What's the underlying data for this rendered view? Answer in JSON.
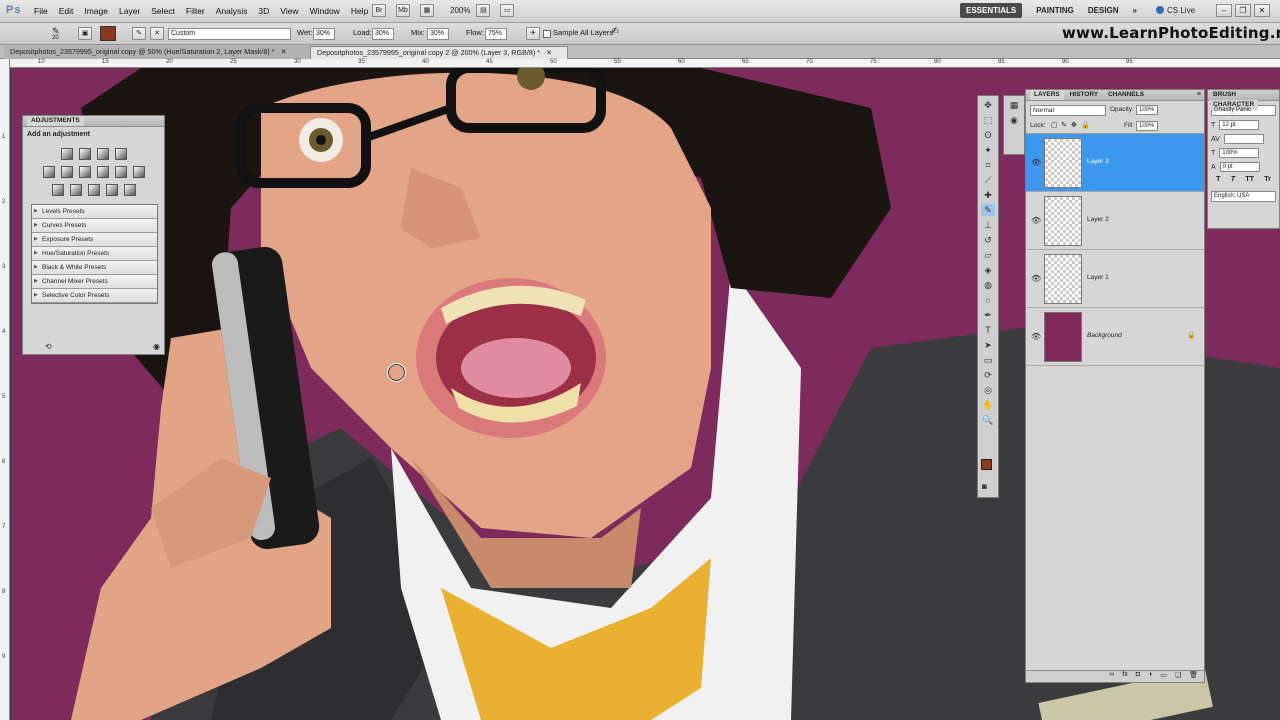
{
  "menubar": {
    "logo": "Ps",
    "items": [
      "File",
      "Edit",
      "Image",
      "Layer",
      "Select",
      "Filter",
      "Analysis",
      "3D",
      "View",
      "Window",
      "Help"
    ],
    "zoom": "200%",
    "workspaces": [
      "ESSENTIALS",
      "PAINTING",
      "DESIGN"
    ],
    "more": "»",
    "cslive": "CS Live",
    "window_controls": [
      "–",
      "❐",
      "✕"
    ]
  },
  "options": {
    "brush_size": "20",
    "preset": "Custom",
    "wet_label": "Wet:",
    "wet_value": "30%",
    "load_label": "Load:",
    "load_value": "30%",
    "mix_label": "Mix:",
    "mix_value": "30%",
    "flow_label": "Flow:",
    "flow_value": "75%",
    "sample_label": "Sample All Layers",
    "brand": "www.LearnPhotoEditing.net",
    "fg_color": "#8b3a1f"
  },
  "doctabs": [
    {
      "title": "Depositphotos_23579995_original copy @ 50% (Hue/Saturation 2, Layer Mask/8) *",
      "close": "✕"
    },
    {
      "title": "Depositphotos_23579995_original copy 2 @ 200% (Layer 3, RGB/8) *",
      "close": "✕"
    }
  ],
  "ruler": {
    "top": [
      "10",
      "15",
      "20",
      "25",
      "30",
      "35",
      "40",
      "45",
      "50",
      "55",
      "60",
      "65",
      "70",
      "75",
      "80",
      "85",
      "90",
      "95"
    ],
    "left": [
      "1",
      "2",
      "3",
      "4",
      "5",
      "6",
      "7",
      "8",
      "9"
    ]
  },
  "adjustments": {
    "tab": "ADJUSTMENTS",
    "title": "Add an adjustment",
    "presets": [
      "Levels Presets",
      "Curves Presets",
      "Exposure Presets",
      "Hue/Saturation Presets",
      "Black & White Presets",
      "Channel Mixer Presets",
      "Selective Color Presets"
    ]
  },
  "layers_panel": {
    "tabs": [
      "LAYERS",
      "HISTORY",
      "CHANNELS"
    ],
    "blend_mode": "Normal",
    "opacity_label": "Opacity:",
    "opacity_value": "100%",
    "lock_label": "Lock:",
    "fill_label": "Fill:",
    "fill_value": "100%",
    "layers": [
      "Layer 3",
      "Layer 2",
      "Layer 1",
      "Background"
    ],
    "selected_color": "#3c97ef"
  },
  "character_panel": {
    "tabs": [
      "BRUSH",
      "CHARACTER"
    ],
    "font": "Ghastly Panic",
    "size": "12 pt",
    "scale": "100%",
    "baseline": "0 pt",
    "styles": [
      "T",
      "T",
      "TT",
      "Tr"
    ],
    "language": "English: USA"
  }
}
